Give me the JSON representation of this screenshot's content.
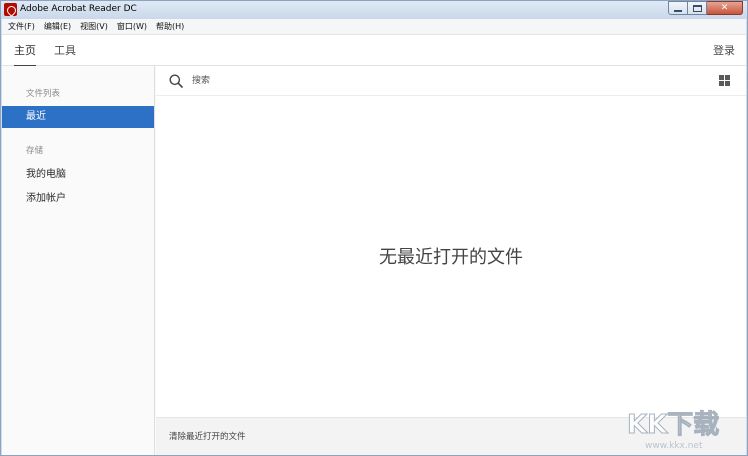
{
  "window": {
    "title": "Adobe Acrobat Reader DC",
    "close_glyph": "✕"
  },
  "menubar": {
    "items": [
      "文件(F)",
      "编辑(E)",
      "视图(V)",
      "窗口(W)",
      "帮助(H)"
    ]
  },
  "topnav": {
    "tabs": [
      "主页",
      "工具"
    ],
    "signin_label": "登录"
  },
  "sidebar": {
    "section_files": "文件列表",
    "recent_label": "最近",
    "section_storage": "存储",
    "my_computer_label": "我的电脑",
    "add_account_label": "添加帐户"
  },
  "main": {
    "search_placeholder": "搜索",
    "empty_message": "无最近打开的文件",
    "clear_recent_label": "清除最近打开的文件"
  },
  "watermark": {
    "brand": "KK下载",
    "url": "www.kkx.net"
  },
  "colors": {
    "accent": "#2d71c7",
    "app_icon": "#b30b00"
  }
}
